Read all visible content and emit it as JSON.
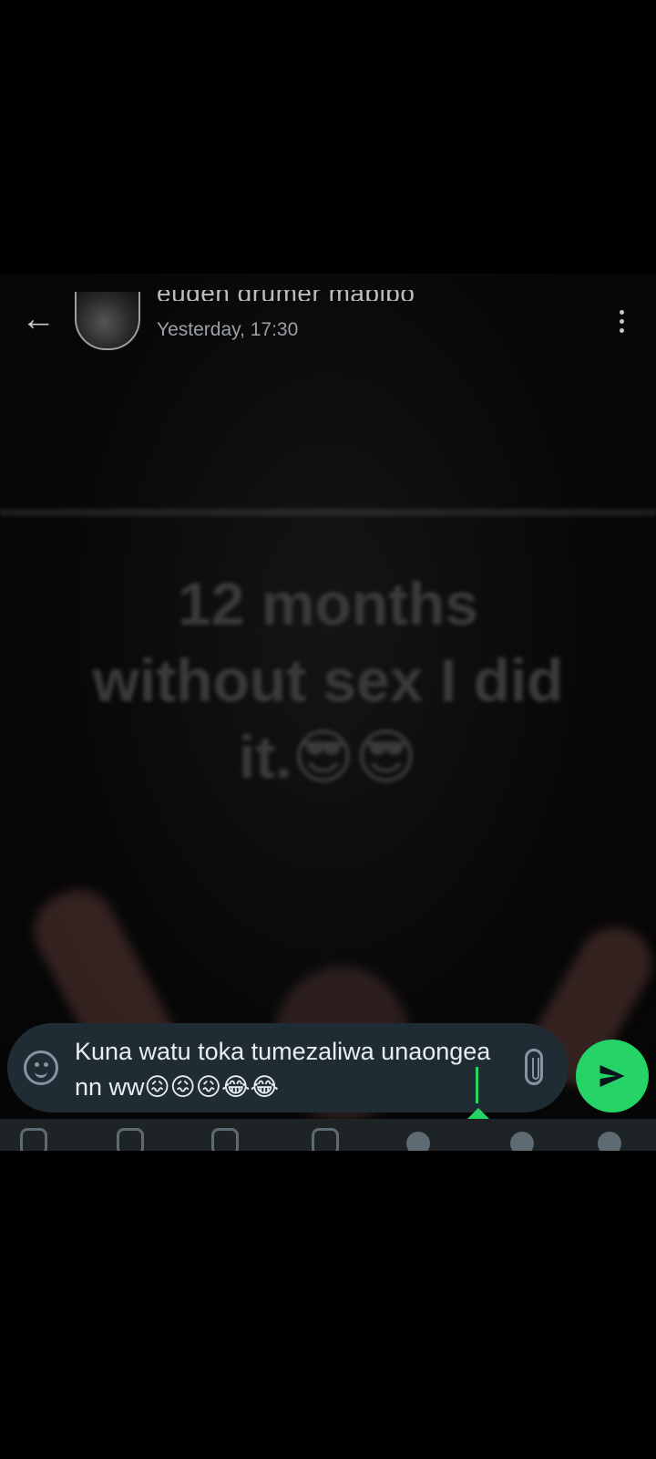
{
  "header": {
    "contact_name": "eugen drumer mabibo",
    "last_seen": "Yesterday, 17:30",
    "back_icon": "arrow-left-icon",
    "menu_icon": "more-vert-icon"
  },
  "status": {
    "text_line1": "12 months",
    "text_line2": "without sex I did",
    "text_line3": "it.😎😎"
  },
  "composer": {
    "message_text": "Kuna watu toka tumezaliwa unaongea nn ww😖😖😖😂😂",
    "emoji_icon": "emoji-icon",
    "attach_icon": "paperclip-icon",
    "send_icon": "send-icon"
  },
  "colors": {
    "accent": "#25d366",
    "composer_bg": "#1f2c34",
    "icon_gray": "#8696a0"
  }
}
